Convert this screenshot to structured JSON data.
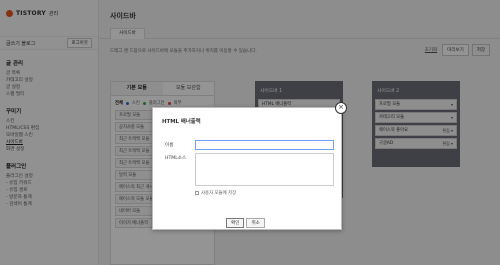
{
  "brand": {
    "logo": "TISTORY",
    "section": "관리"
  },
  "account": {
    "name": "글쓰기 블로그",
    "logout": "로그아웃"
  },
  "menu": [
    {
      "title": "글 관리",
      "items": [
        "글 목록",
        "카테고리 설정",
        "글 설정",
        "스팸 필터"
      ]
    },
    {
      "title": "꾸미기",
      "items": [
        "스킨",
        "HTML/CSS 편집",
        "모바일웹 스킨",
        "사이드바",
        "화면 설정"
      ],
      "active": "사이드바"
    },
    {
      "title": "플러그인",
      "items": [
        "플러그인 설정",
        "- 유입 키워드",
        "- 유입 경로",
        "- 방문자 통계",
        "- 검색어 통계"
      ]
    }
  ],
  "page": {
    "title": "사이드바",
    "tab": "사이드바",
    "description": "드래그 앤 드랍으로 사이드바에 모듈을 추가하거나 위치를 이동할 수 있습니다."
  },
  "tools": {
    "reset": "초기화",
    "preview": "미리보기",
    "save": "저장"
  },
  "modules": {
    "tabs": [
      "기본 모듈",
      "모듈 보관함"
    ],
    "filters": [
      {
        "label": "전체",
        "color": "#333333"
      },
      {
        "label": "스킨",
        "color": "#3b6fd1"
      },
      {
        "label": "플러그인",
        "color": "#35a852"
      },
      {
        "label": "외부",
        "color": "#e0483c"
      }
    ],
    "items": [
      "프로필 모듈",
      "공지사항 모듈",
      "최근 트랙백 모듈",
      "최근 트랙백 모듈",
      "최근 트랙백 모듈",
      "달력 모듈",
      "페이스북 최근 게시물",
      "페이스북 모듈 모듈",
      "네이버 모듈",
      "이미지 배너출력"
    ]
  },
  "columns": [
    {
      "title": "사이드바 1",
      "items": [
        "HTML 배너출력",
        "",
        "",
        "",
        "",
        "",
        "",
        ""
      ]
    },
    {
      "title": "사이드바 2",
      "items": [
        "프로필 모듈",
        "카테고리 모듈",
        "페이스북 좋아요",
        "구글AD"
      ],
      "edits": [
        "",
        "",
        "편집",
        "편집"
      ]
    }
  ],
  "modal": {
    "title": "HTML 배너출력",
    "name_label": "이름",
    "html_label": "HTML소스",
    "checkbox_label": "사용자 모듈에 저장",
    "confirm": "확인",
    "cancel": "취소",
    "close": "×"
  }
}
